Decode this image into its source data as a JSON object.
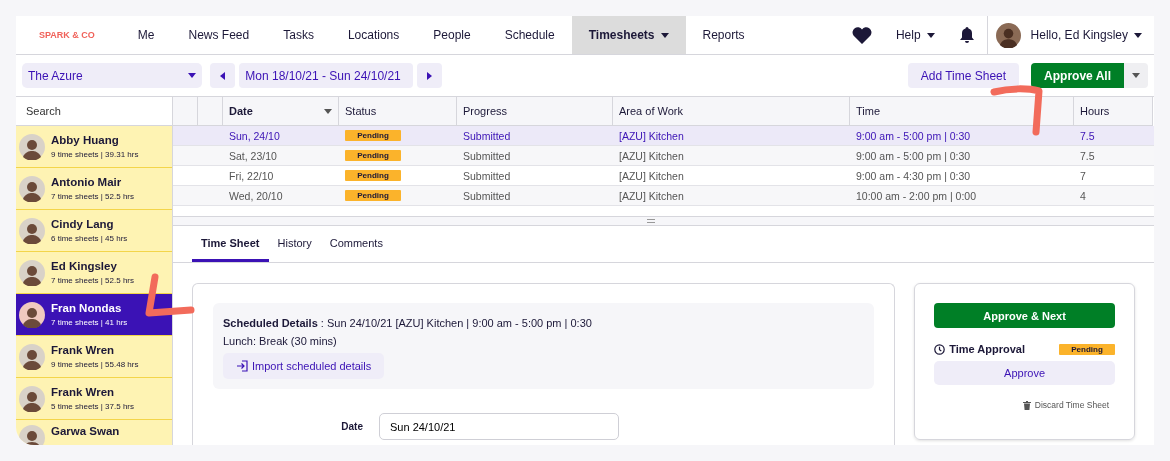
{
  "nav": {
    "logo": "SPARK & CO",
    "items": [
      {
        "label": "Me",
        "selected": false,
        "dropdown": false
      },
      {
        "label": "News Feed",
        "selected": false,
        "dropdown": false
      },
      {
        "label": "Tasks",
        "selected": false,
        "dropdown": false
      },
      {
        "label": "Locations",
        "selected": false,
        "dropdown": false
      },
      {
        "label": "People",
        "selected": false,
        "dropdown": false
      },
      {
        "label": "Schedule",
        "selected": false,
        "dropdown": false
      },
      {
        "label": "Timesheets",
        "selected": true,
        "dropdown": true
      },
      {
        "label": "Reports",
        "selected": false,
        "dropdown": false
      }
    ],
    "help": "Help",
    "user": "Hello, Ed Kingsley"
  },
  "toolbar": {
    "location": "The Azure",
    "date_range": "Mon 18/10/21 - Sun 24/10/21",
    "add_button": "Add Time Sheet",
    "approve_all": "Approve All"
  },
  "sidebar": {
    "search_placeholder": "Search",
    "people": [
      {
        "name": "Abby Huang",
        "summary": "9 time sheets | 39.31 hrs",
        "selected": false
      },
      {
        "name": "Antonio Mair",
        "summary": "7 time sheets | 52.5 hrs",
        "selected": false
      },
      {
        "name": "Cindy Lang",
        "summary": "6 time sheets | 45 hrs",
        "selected": false
      },
      {
        "name": "Ed Kingsley",
        "summary": "7 time sheets | 52.5 hrs",
        "selected": false
      },
      {
        "name": "Fran Nondas",
        "summary": "7 time sheets | 41 hrs",
        "selected": true
      },
      {
        "name": "Frank Wren",
        "summary": "9 time sheets | 55.48 hrs",
        "selected": false
      },
      {
        "name": "Frank Wren",
        "summary": "5 time sheets | 37.5 hrs",
        "selected": false
      },
      {
        "name": "Garwa Swan",
        "selected": false
      }
    ]
  },
  "table": {
    "columns": [
      "Date",
      "Status",
      "Progress",
      "Area of Work",
      "Time",
      "Hours"
    ],
    "rows": [
      {
        "date": "Sun, 24/10",
        "status": "Pending",
        "progress": "Submitted",
        "area": "[AZU] Kitchen",
        "time": "9:00 am - 5:00 pm | 0:30",
        "hours": "7.5",
        "selected": true
      },
      {
        "date": "Sat, 23/10",
        "status": "Pending",
        "progress": "Submitted",
        "area": "[AZU] Kitchen",
        "time": "9:00 am - 5:00 pm | 0:30",
        "hours": "7.5",
        "selected": false
      },
      {
        "date": "Fri, 22/10",
        "status": "Pending",
        "progress": "Submitted",
        "area": "[AZU] Kitchen",
        "time": "9:00 am - 4:30 pm | 0:30",
        "hours": "7",
        "selected": false
      },
      {
        "date": "Wed, 20/10",
        "status": "Pending",
        "progress": "Submitted",
        "area": "[AZU] Kitchen",
        "time": "10:00 am - 2:00 pm | 0:00",
        "hours": "4",
        "selected": false
      }
    ]
  },
  "detail": {
    "tabs": [
      {
        "label": "Time Sheet",
        "selected": true
      },
      {
        "label": "History",
        "selected": false
      },
      {
        "label": "Comments",
        "selected": false
      }
    ],
    "scheduled": "**Scheduled Details** : Sun 24/10/21 [AZU] Kitchen | 9:00 am - 5:00 pm | 0:30",
    "lunch": "Lunch: Break (30 mins)",
    "import_button": "Import scheduled details",
    "date_label": "Date",
    "date_value": "Sun 24/10/21"
  },
  "approval": {
    "next_button": "Approve & Next",
    "title": "Time Approval",
    "status": "Pending",
    "approve_button": "Approve",
    "discard": "Discard Time Sheet"
  }
}
